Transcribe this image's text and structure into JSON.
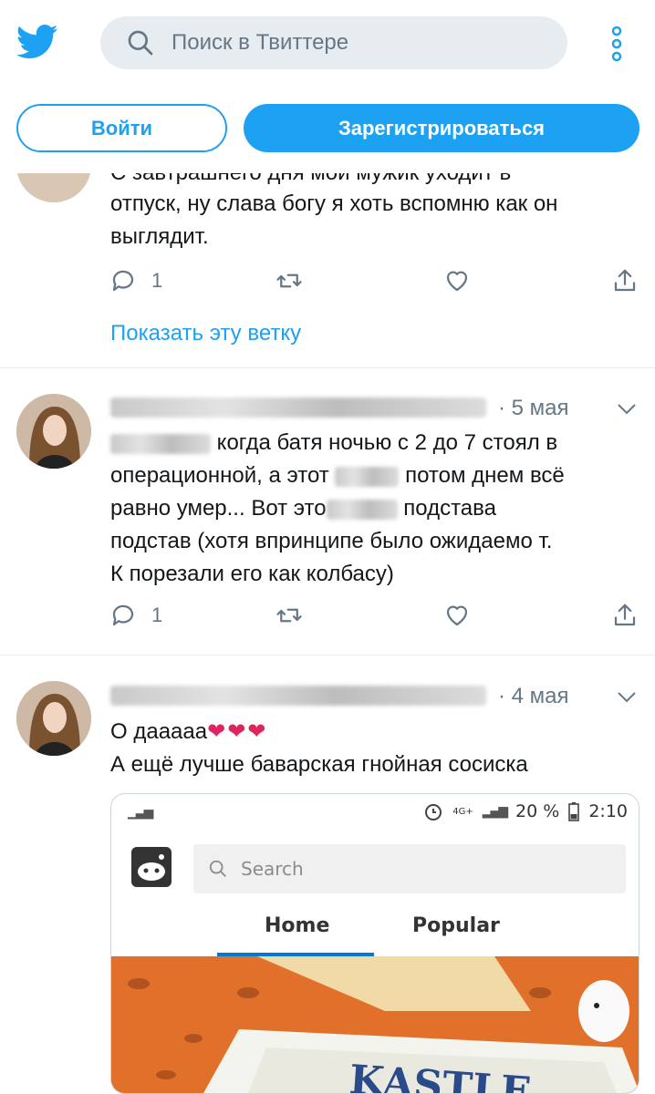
{
  "header": {
    "search_placeholder": "Поиск в Твиттере",
    "login_label": "Войти",
    "signup_label": "Зарегистрироваться",
    "accent_color": "#1da1f2"
  },
  "tweets": [
    {
      "text_lines": [
        "С завтрашнего дня мой мужик уходит в",
        "отпуск, ну слава богу я хоть вспомню как он",
        "выглядит."
      ],
      "reply_count": "1",
      "show_thread": "Показать эту ветку"
    },
    {
      "date": "· 5 мая",
      "lines": [
        {
          "after_blur": "когда батя  ночью с 2 до 7 стоял в"
        },
        {
          "before": "операционной, а этот",
          "after": "потом днем всё"
        },
        {
          "before": "равно умер... Вот это",
          "after": "подстава"
        },
        {
          "text": "подстав (хотя впринципе было ожидаемо т."
        },
        {
          "text": "К порезали его как колбасу)"
        }
      ],
      "reply_count": "1"
    },
    {
      "date": "· 4 мая",
      "line1": "О дааааа",
      "hearts": "❤❤❤",
      "line2": "А ещё лучше баварская гнойная сосиска",
      "embed": {
        "status_right": "20 %",
        "time": "2:10",
        "network": "4G+",
        "search_placeholder": "Search",
        "tab_home": "Home",
        "tab_popular": "Popular",
        "image_text": "KASTLE"
      }
    }
  ],
  "icons": [
    "twitter-bird-icon",
    "search-icon",
    "more-vertical-icon",
    "reply-icon",
    "retweet-icon",
    "like-icon",
    "share-icon",
    "chevron-down-icon",
    "heart-icon"
  ]
}
